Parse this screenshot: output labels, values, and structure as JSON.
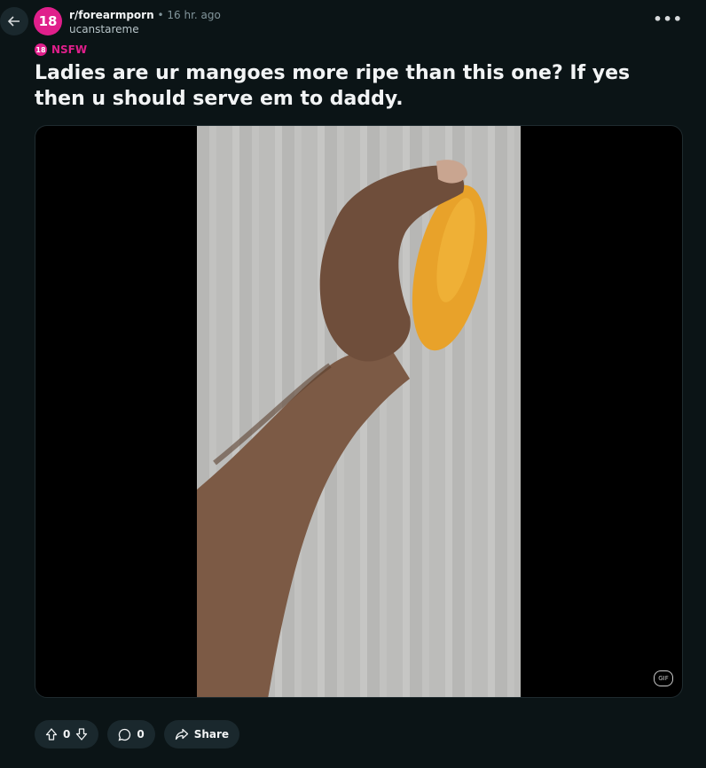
{
  "post": {
    "subreddit": "r/forearmporn",
    "separator": "•",
    "time": "16 hr. ago",
    "author": "ucanstareme",
    "avatar_text": "18",
    "nsfw_badge_text": "18",
    "nsfw_label": "NSFW",
    "title": "Ladies are ur mangoes more ripe than this one? If yes then u should serve em to daddy.",
    "more_label": "•••",
    "gif_label": "GIF"
  },
  "actions": {
    "score": "0",
    "comments": "0",
    "share_label": "Share"
  },
  "colors": {
    "background": "#0b1416",
    "nsfw_pink": "#e01f8b",
    "pill_bg": "#1a282d"
  },
  "icons": [
    "back-arrow-icon",
    "more-icon",
    "upvote-icon",
    "downvote-icon",
    "comment-icon",
    "share-icon"
  ]
}
